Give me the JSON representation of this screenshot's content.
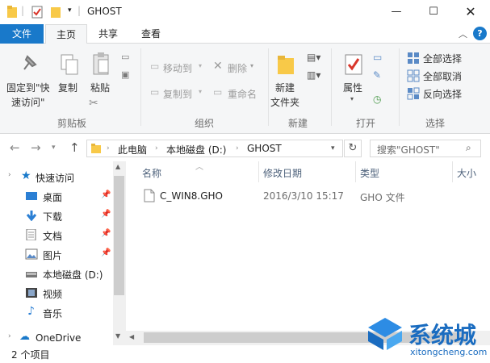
{
  "window": {
    "title": "GHOST",
    "controls": [
      "minimize",
      "maximize",
      "close"
    ]
  },
  "tabs": {
    "file": "文件",
    "home": "主页",
    "share": "共享",
    "view": "查看"
  },
  "ribbon": {
    "pin_quick_access": "固定到\"快\n速访问\"",
    "pin_line1": "固定到\"快",
    "pin_line2": "速访问\"",
    "copy": "复制",
    "paste": "粘贴",
    "move_to": "移动到",
    "copy_to": "复制到",
    "delete": "删除",
    "rename": "重命名",
    "new_folder_line1": "新建",
    "new_folder_line2": "文件夹",
    "properties": "属性",
    "select_all": "全部选择",
    "select_none": "全部取消",
    "invert_selection": "反向选择",
    "groups": {
      "clipboard": "剪贴板",
      "organize": "组织",
      "new": "新建",
      "open": "打开",
      "select": "选择"
    }
  },
  "address": {
    "crumbs": [
      "此电脑",
      "本地磁盘 (D:)",
      "GHOST"
    ],
    "search_placeholder": "搜索\"GHOST\""
  },
  "nav": {
    "quick_access": "快速访问",
    "items": [
      {
        "label": "桌面",
        "pinned": true
      },
      {
        "label": "下载",
        "pinned": true
      },
      {
        "label": "文档",
        "pinned": true
      },
      {
        "label": "图片",
        "pinned": true
      },
      {
        "label": "本地磁盘 (D:)",
        "pinned": false
      },
      {
        "label": "视频",
        "pinned": false
      },
      {
        "label": "音乐",
        "pinned": false
      }
    ],
    "onedrive": "OneDrive"
  },
  "columns": {
    "name": "名称",
    "modified": "修改日期",
    "type": "类型",
    "size": "大小"
  },
  "files": [
    {
      "name": "C_WIN8.GHO",
      "modified": "2016/3/10 15:17",
      "type": "GHO 文件"
    }
  ],
  "status": {
    "count": "2 个项目"
  },
  "watermark": {
    "brand": "系统城",
    "url": "xitongcheng.com"
  },
  "colors": {
    "accent": "#1979ca",
    "folder": "#f8c948",
    "ribbon_bg": "#f5f6f7"
  }
}
